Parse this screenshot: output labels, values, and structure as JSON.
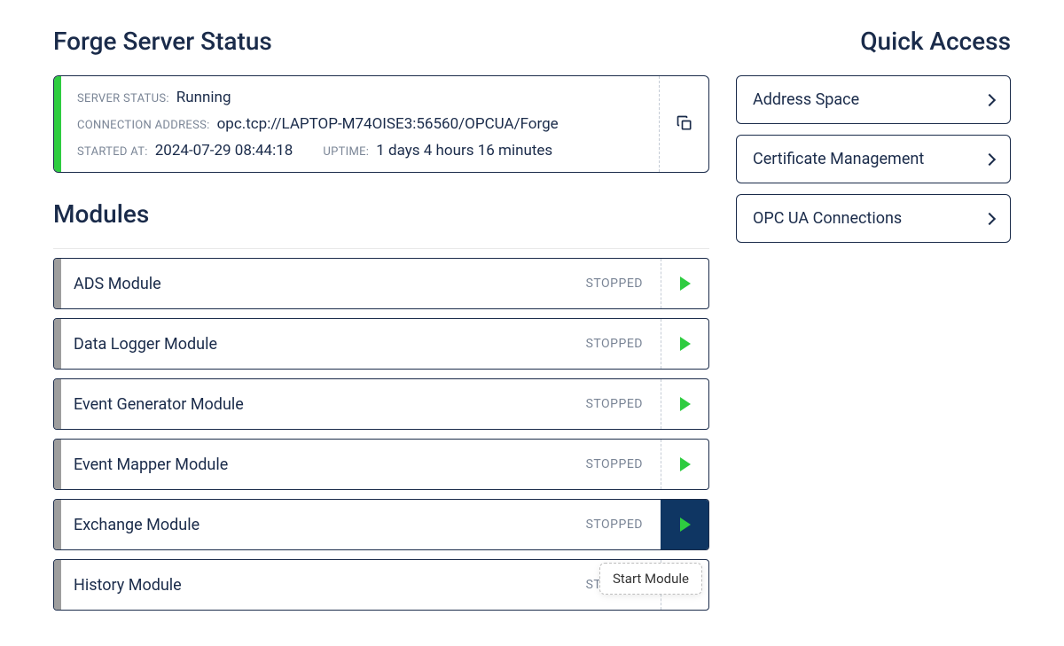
{
  "sections": {
    "server_status_title": "Forge Server Status",
    "modules_title": "Modules",
    "quick_access_title": "Quick Access"
  },
  "server_status": {
    "labels": {
      "status": "SERVER STATUS:",
      "address": "CONNECTION ADDRESS:",
      "started": "STARTED AT:",
      "uptime": "UPTIME:"
    },
    "status": "Running",
    "address": "opc.tcp://LAPTOP-M74OISE3:56560/OPCUA/Forge",
    "started_at": "2024-07-29 08:44:18",
    "uptime": "1 days 4 hours 16 minutes",
    "status_color": "#2ecc40"
  },
  "modules": [
    {
      "name": "ADS Module",
      "status": "STOPPED",
      "action_active": false
    },
    {
      "name": "Data Logger Module",
      "status": "STOPPED",
      "action_active": false
    },
    {
      "name": "Event Generator Module",
      "status": "STOPPED",
      "action_active": false
    },
    {
      "name": "Event Mapper Module",
      "status": "STOPPED",
      "action_active": false
    },
    {
      "name": "Exchange Module",
      "status": "STOPPED",
      "action_active": true
    },
    {
      "name": "History Module",
      "status": "STOPPED",
      "action_active": false
    }
  ],
  "tooltip": "Start Module",
  "quick_access": [
    {
      "label": "Address Space"
    },
    {
      "label": "Certificate Management"
    },
    {
      "label": "OPC UA Connections"
    }
  ]
}
